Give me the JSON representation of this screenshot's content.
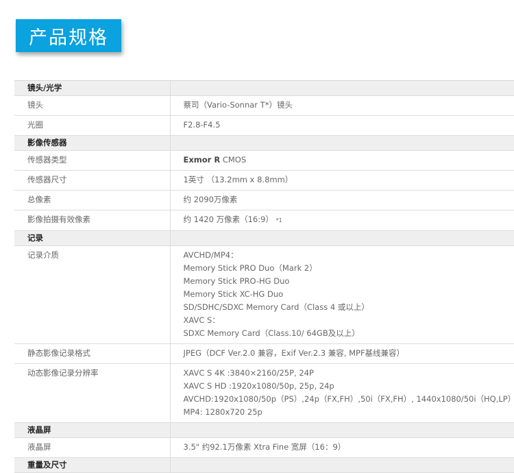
{
  "header": {
    "title": "产品规格"
  },
  "sections": {
    "lens": {
      "title": "镜头/光学",
      "rows": {
        "lens": {
          "label": "镜头",
          "value": "蔡司（Vario-Sonnar T*）镜头"
        },
        "aperture": {
          "label": "光圈",
          "value": "F2.8-F4.5"
        }
      }
    },
    "sensor": {
      "title": "影像传感器",
      "rows": {
        "type": {
          "label": "传感器类型",
          "value_bold": "Exmor R",
          "value_rest": " CMOS"
        },
        "size": {
          "label": "传感器尺寸",
          "value": "1英寸 （13.2mm x 8.8mm）"
        },
        "total": {
          "label": "总像素",
          "value": "约 2090万像素"
        },
        "effective": {
          "label": "影像拍摄有效像素",
          "value": "约 1420 万像素（16:9）",
          "note": "*1"
        }
      }
    },
    "recording": {
      "title": "记录",
      "rows": {
        "media": {
          "label": "记录介质",
          "lines": [
            "AVCHD/MP4：",
            "Memory Stick PRO Duo（Mark 2）",
            "Memory Stick PRO-HG Duo",
            "Memory Stick XC-HG Duo",
            "SD/SDHC/SDXC Memory Card（Class 4 或以上）",
            "XAVC S：",
            "SDXC Memory Card（Class.10/ 64GB及以上）"
          ]
        },
        "still_format": {
          "label": "静态影像记录格式",
          "value": "JPEG（DCF Ver.2.0 兼容，Exif Ver.2.3 兼容, MPF基线兼容）"
        },
        "movie_res": {
          "label": "动态影像记录分辨率",
          "lines": [
            "XAVC S 4K :3840×2160/25P, 24P",
            "XAVC S HD :1920x1080/50p, 25p, 24p",
            "AVCHD:1920x1080/50p（PS）,24p（FX,FH）,50i（FX,FH）, 1440x1080/50i（HQ,LP）",
            "MP4: 1280x720 25p"
          ]
        }
      }
    },
    "lcd": {
      "title": "液晶屏",
      "rows": {
        "lcd": {
          "label": "液晶屏",
          "value": "3.5\" 约92.1万像素 Xtra Fine 宽屏（16：9）"
        }
      }
    },
    "weight": {
      "title": "重量及尺寸"
    }
  }
}
